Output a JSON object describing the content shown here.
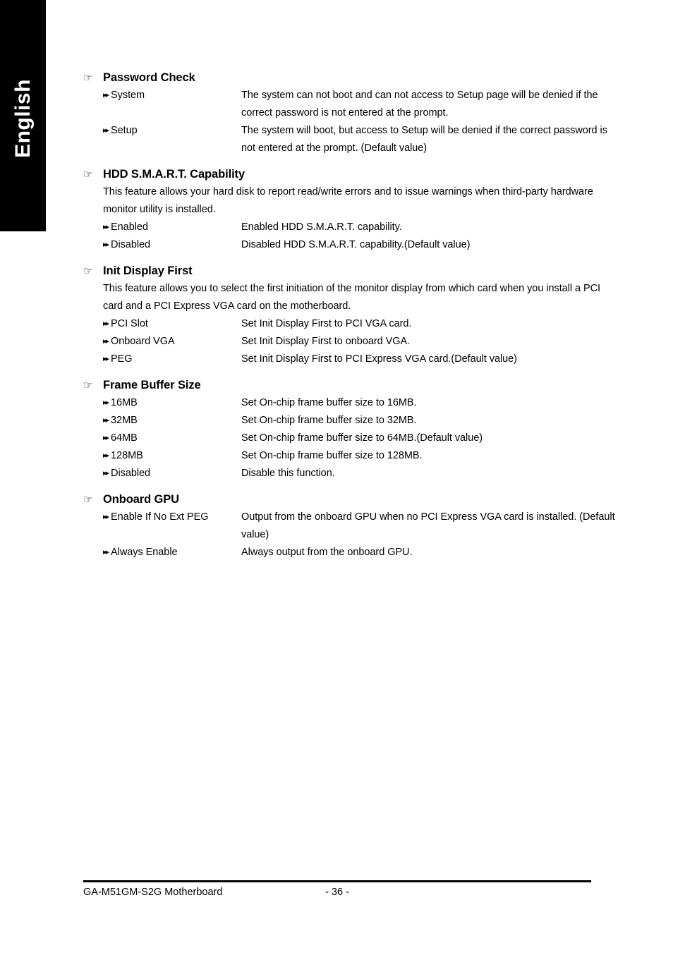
{
  "sidebar": {
    "language_tab": "English"
  },
  "icons": {
    "hand": "☞",
    "arrows": "▸▸"
  },
  "sections": [
    {
      "title": "Password Check",
      "description": null,
      "options": [
        {
          "label": "System",
          "desc": "The system can not boot and can not access to Setup page will be denied if the correct password is not entered at the prompt."
        },
        {
          "label": "Setup",
          "desc": "The system will boot, but access to Setup will be denied if the correct password is not entered at the prompt. (Default value)"
        }
      ]
    },
    {
      "title": "HDD S.M.A.R.T. Capability",
      "description": "This feature allows your hard disk to report read/write errors and to issue warnings when third-party hardware monitor utility is installed.",
      "options": [
        {
          "label": "Enabled",
          "desc": "Enabled HDD S.M.A.R.T. capability."
        },
        {
          "label": "Disabled",
          "desc": "Disabled HDD S.M.A.R.T. capability.(Default value)"
        }
      ]
    },
    {
      "title": "Init Display First",
      "description": "This feature allows you to select the first initiation of the monitor display from which card when you install a PCI card and a PCI Express VGA card on the motherboard.",
      "options": [
        {
          "label": "PCI Slot",
          "desc": "Set Init Display First to PCI VGA card."
        },
        {
          "label": "Onboard VGA",
          "desc": "Set Init Display First to onboard VGA."
        },
        {
          "label": "PEG",
          "desc": "Set Init Display First to PCI Express VGA card.(Default value)"
        }
      ]
    },
    {
      "title": "Frame Buffer Size",
      "description": null,
      "options": [
        {
          "label": "16MB",
          "desc": "Set On-chip frame buffer size to 16MB."
        },
        {
          "label": "32MB",
          "desc": "Set On-chip frame buffer size to 32MB."
        },
        {
          "label": "64MB",
          "desc": "Set On-chip frame buffer size to 64MB.(Default value)"
        },
        {
          "label": "128MB",
          "desc": "Set On-chip frame buffer size to 128MB."
        },
        {
          "label": "Disabled",
          "desc": "Disable this function."
        }
      ]
    },
    {
      "title": "Onboard GPU",
      "description": null,
      "options": [
        {
          "label": "Enable If No Ext PEG",
          "desc": "Output from the onboard GPU when no PCI Express VGA card is installed. (Default value)"
        },
        {
          "label": "Always Enable",
          "desc": "Always output from the onboard GPU."
        }
      ]
    }
  ],
  "footer": {
    "left": "GA-M51GM-S2G Motherboard",
    "page": "- 36 -"
  }
}
